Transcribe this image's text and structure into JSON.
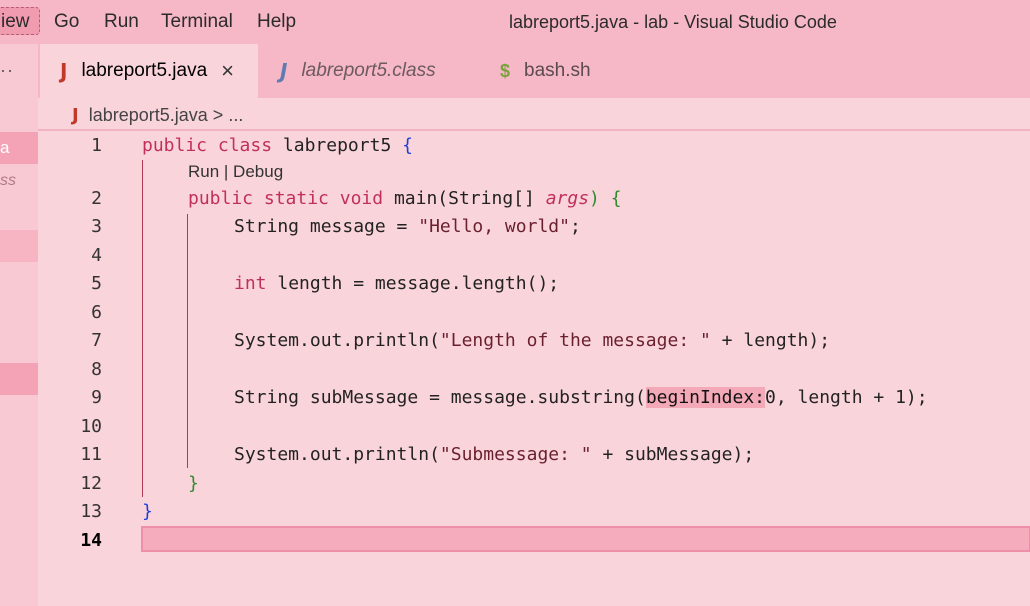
{
  "menu": {
    "view": "iew",
    "go": "Go",
    "run": "Run",
    "terminal": "Terminal",
    "help": "Help"
  },
  "window_title": "labreport5.java - lab - Visual Studio Code",
  "activity": {
    "ellipsis": "··",
    "item_a": "a",
    "item_ss": "ss"
  },
  "tabs": [
    {
      "label": "labreport5.java",
      "icon": "java-icon",
      "close": "×"
    },
    {
      "label": "labreport5.class",
      "icon": "java-icon"
    },
    {
      "label": "bash.sh",
      "icon": "dollar-icon",
      "glyph": "$"
    }
  ],
  "java_glyph": "J",
  "breadcrumb": {
    "file": "labreport5.java",
    "sep": ">",
    "more": "..."
  },
  "codelens": "Run | Debug",
  "line_numbers": [
    "1",
    "2",
    "3",
    "4",
    "5",
    "6",
    "7",
    "8",
    "9",
    "10",
    "11",
    "12",
    "13",
    "14"
  ],
  "code": {
    "l1": {
      "a": "public",
      "b": "class",
      "c": "labreport5",
      "d": "{"
    },
    "l2": {
      "a": "public",
      "b": "static",
      "c": "void",
      "d": "main(String[]",
      "e": "args",
      "f": ") {"
    },
    "l3": {
      "a": "String message = ",
      "b": "\"Hello, world\"",
      "c": ";"
    },
    "l5": {
      "a": "int",
      "b": " length = message.length();"
    },
    "l7": {
      "a": "System.out.println(",
      "b": "\"Length of the message: \"",
      "c": " + length);"
    },
    "l9": {
      "a": "String subMessage = message.substring(",
      "b": "beginIndex:",
      "c": "0, length + 1);"
    },
    "l11": {
      "a": "System.out.println(",
      "b": "\"Submessage: \"",
      "c": " + subMessage);"
    },
    "l12": "}",
    "l13": "}"
  }
}
